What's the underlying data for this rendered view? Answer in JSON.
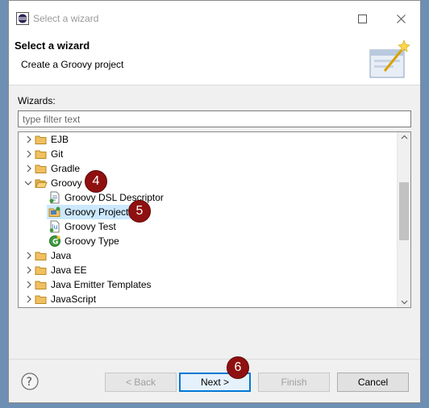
{
  "window": {
    "title": "Select a wizard"
  },
  "header": {
    "title": "Select a wizard",
    "description": "Create a Groovy project"
  },
  "wizards_label": "Wizards:",
  "filter": {
    "value": "",
    "placeholder": "type filter text"
  },
  "tree": {
    "items": [
      {
        "label": "EJB",
        "type": "folder",
        "expanded": false
      },
      {
        "label": "Git",
        "type": "folder",
        "expanded": false
      },
      {
        "label": "Gradle",
        "type": "folder",
        "expanded": false
      },
      {
        "label": "Groovy",
        "type": "folder",
        "expanded": true
      },
      {
        "label": "Groovy DSL Descriptor",
        "type": "file"
      },
      {
        "label": "Groovy Project",
        "type": "project",
        "selected": true
      },
      {
        "label": "Groovy Test",
        "type": "test"
      },
      {
        "label": "Groovy Type",
        "type": "groovy-type"
      },
      {
        "label": "Java",
        "type": "folder",
        "expanded": false
      },
      {
        "label": "Java EE",
        "type": "folder",
        "expanded": false
      },
      {
        "label": "Java Emitter Templates",
        "type": "folder",
        "expanded": false
      },
      {
        "label": "JavaScript",
        "type": "folder",
        "expanded": false
      }
    ]
  },
  "badges": {
    "step4": "4",
    "step5": "5",
    "step6": "6"
  },
  "buttons": {
    "back": "< Back",
    "next": "Next >",
    "finish": "Finish",
    "cancel": "Cancel"
  },
  "colors": {
    "badge": "#8f1010",
    "selection": "#cce8ff",
    "default_button_border": "#0078d7"
  }
}
